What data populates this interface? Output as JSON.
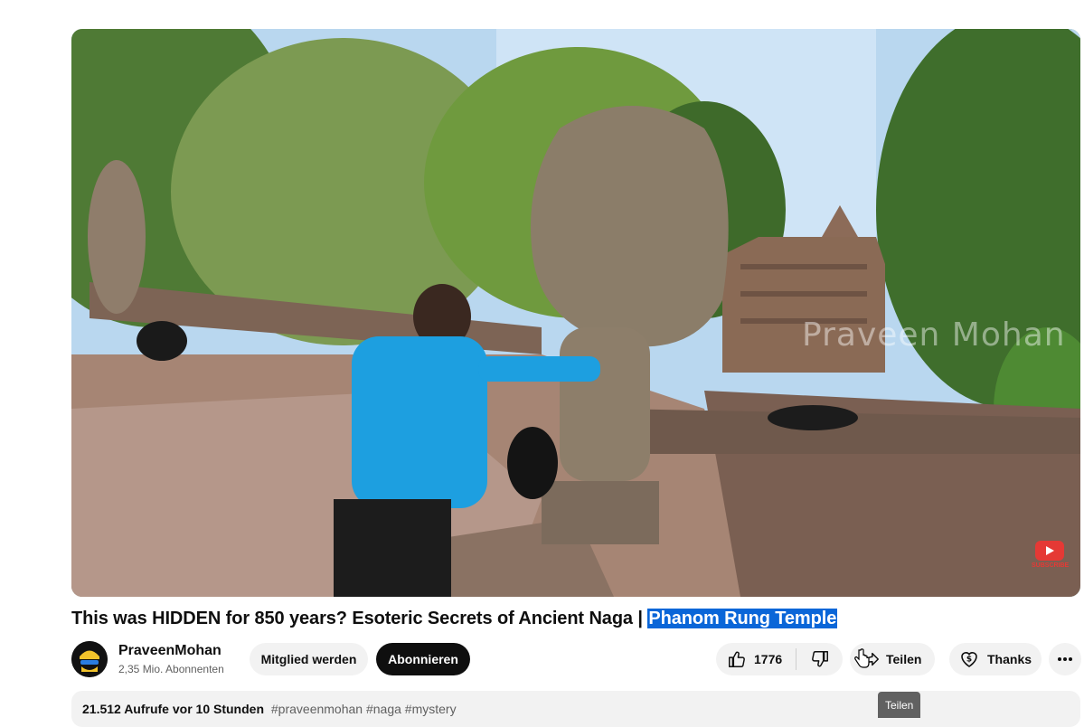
{
  "video": {
    "watermark": "Praveen Mohan",
    "subscribe_badge": "SUBSCRIBE",
    "title_main": "This was HIDDEN for 850 years? Esoteric Secrets of Ancient Naga | ",
    "title_selected": "Phanom Rung Temple"
  },
  "channel": {
    "name": "PraveenMohan",
    "subscribers": "2,35 Mio. Abonnenten",
    "join_label": "Mitglied werden",
    "subscribe_label": "Abonnieren"
  },
  "actions": {
    "like_count": "1776",
    "share_label": "Teilen",
    "thanks_label": "Thanks",
    "tooltip": "Teilen"
  },
  "description": {
    "views": "21.512 Aufrufe",
    "age": "vor 10 Stunden",
    "hashtags": "#praveenmohan #naga #mystery"
  },
  "colors": {
    "selection": "#0a66d8",
    "subscribe_bg": "#0f0f0f",
    "pill_bg": "#f2f2f2"
  }
}
